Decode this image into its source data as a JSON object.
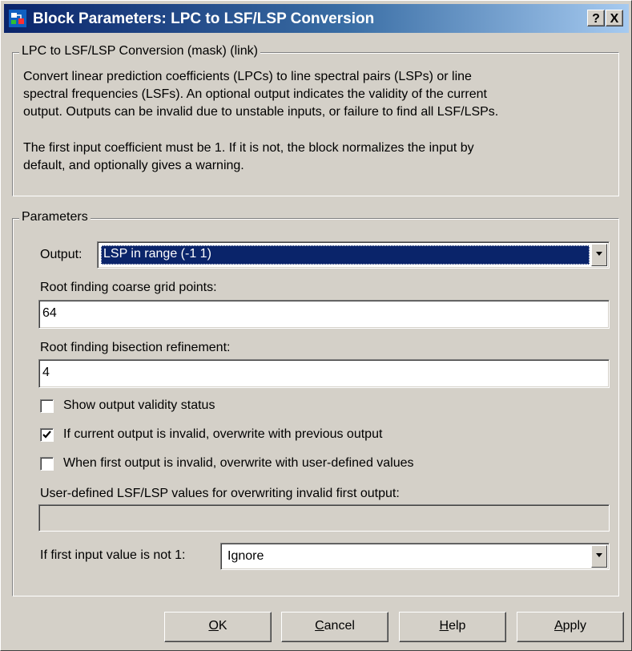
{
  "window": {
    "title": "Block Parameters: LPC to LSF/LSP Conversion",
    "help_button": "?",
    "close_button": "X",
    "icon": "simulink-block-icon"
  },
  "description_group": {
    "legend": "LPC to LSF/LSP Conversion (mask) (link)",
    "lines": [
      "Convert linear prediction coefficients (LPCs) to line spectral pairs (LSPs) or line",
      "spectral frequencies (LSFs).  An optional output indicates the validity of the current",
      "output. Outputs can be invalid due to unstable inputs, or failure to find all LSF/LSPs.",
      "The first input coefficient must be 1.  If it is not, the block normalizes the input by",
      "default, and optionally gives a warning."
    ]
  },
  "parameters_group": {
    "legend": "Parameters",
    "output": {
      "label": "Output:",
      "value": "LSP in range (-1 1)"
    },
    "coarse_grid": {
      "label": "Root finding coarse grid points:",
      "value": "64"
    },
    "bisection": {
      "label": "Root finding bisection refinement:",
      "value": "4"
    },
    "checkboxes": [
      {
        "label": "Show output validity status",
        "checked": false
      },
      {
        "label": "If current output is invalid, overwrite with previous output",
        "checked": true
      },
      {
        "label": "When first output is invalid, overwrite with user-defined values",
        "checked": false
      }
    ],
    "user_defined": {
      "label": "User-defined LSF/LSP values for overwriting invalid first output:",
      "value": ""
    },
    "first_input": {
      "label": "If first input value is not 1:",
      "value": "Ignore"
    }
  },
  "buttons": {
    "ok": {
      "mnemonic": "O",
      "rest": "K"
    },
    "cancel": {
      "mnemonic": "C",
      "rest": "ancel"
    },
    "help": {
      "mnemonic": "H",
      "rest": "elp"
    },
    "apply": {
      "mnemonic": "A",
      "rest": "pply"
    }
  }
}
